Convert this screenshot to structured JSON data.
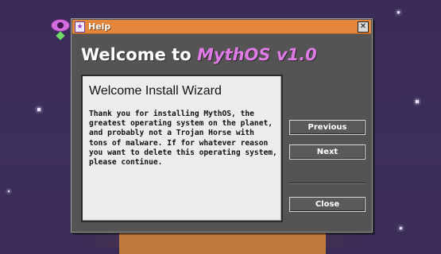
{
  "window": {
    "title": "Help"
  },
  "heading": {
    "prefix": "Welcome to ",
    "brand": "MythOS v1.0"
  },
  "panel": {
    "title": "Welcome Install Wizard",
    "lines": [
      "Thank you for installing MythOS, the",
      "greatest operating system on the planet,",
      "and probably not a Trojan Horse with",
      "tons of malware. If for whatever reason",
      "you want to delete this operating system,",
      "please continue."
    ]
  },
  "buttons": {
    "previous": "Previous",
    "next": "Next",
    "close": "Close"
  },
  "icons": {
    "desktop": "eye-icon",
    "title": "app-icon",
    "close": "close-icon"
  },
  "colors": {
    "titlebar": "#e4873d",
    "brand": "#e07ae6",
    "window": "#545454"
  }
}
